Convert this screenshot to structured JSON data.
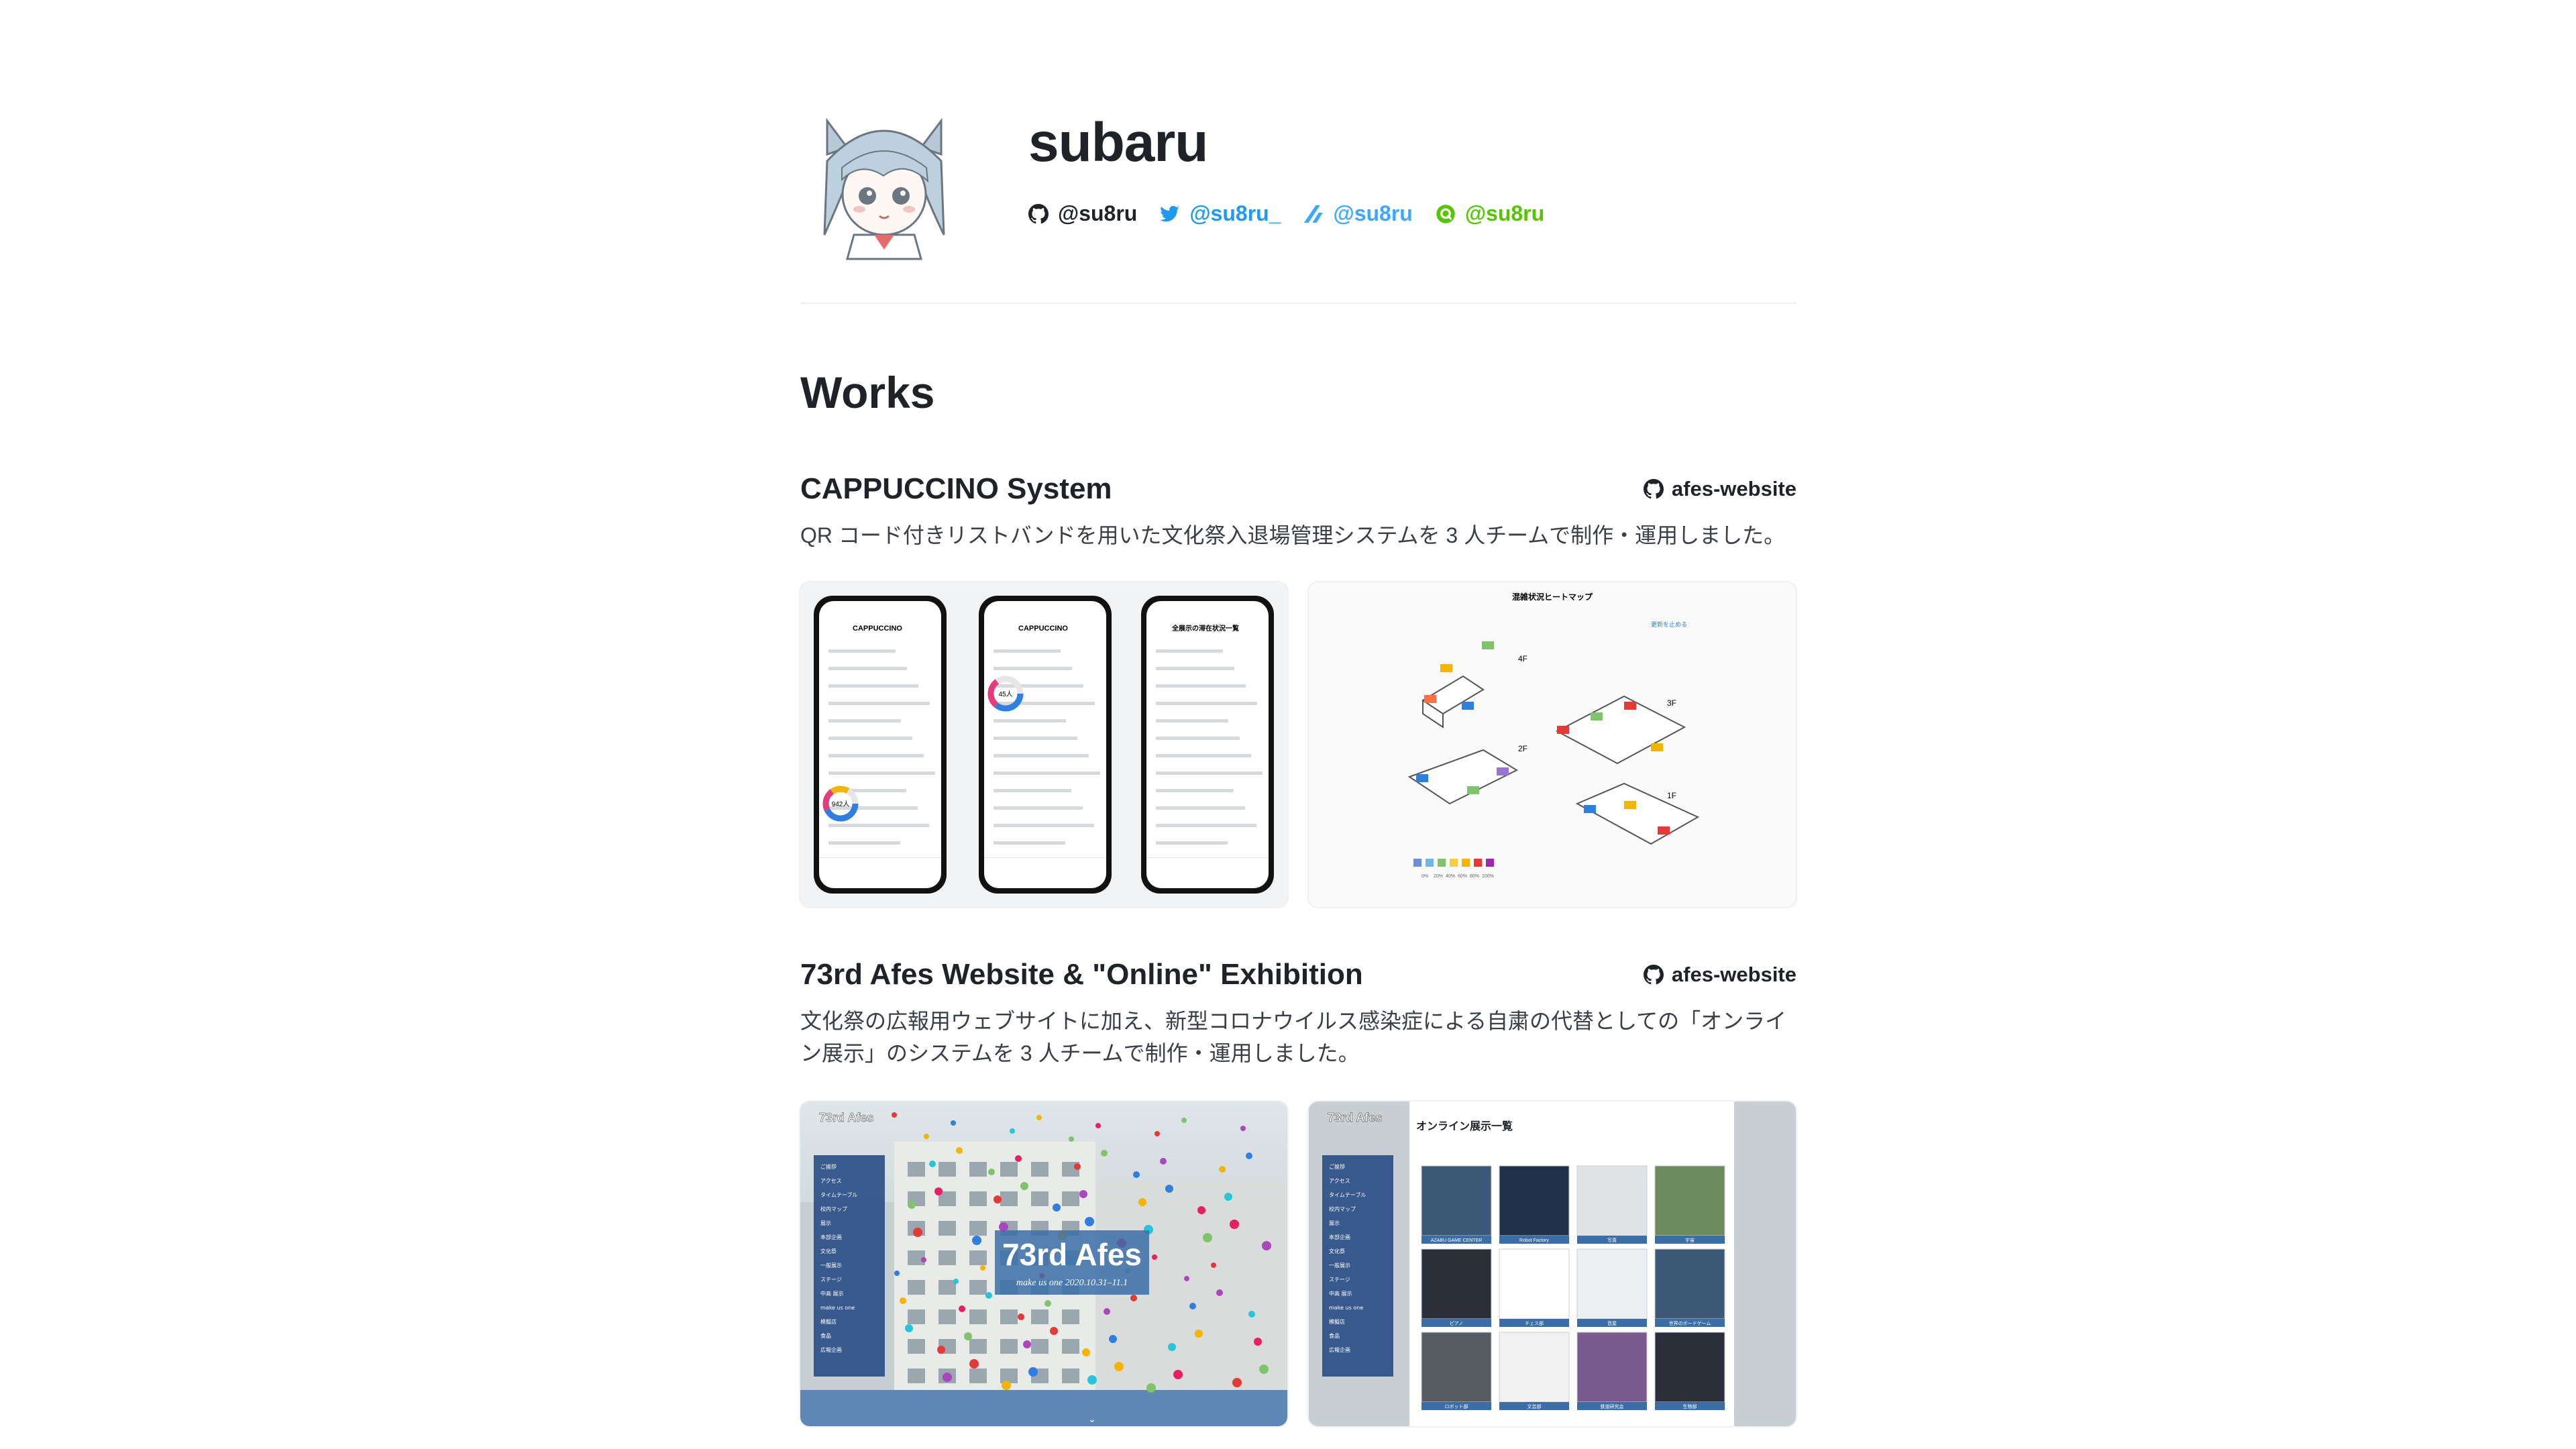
{
  "profile": {
    "name": "subaru",
    "links": [
      {
        "icon": "github-icon",
        "label": "@su8ru"
      },
      {
        "icon": "twitter-icon",
        "label": "@su8ru_"
      },
      {
        "icon": "zenn-icon",
        "label": "@su8ru"
      },
      {
        "icon": "qiita-icon",
        "label": "@su8ru"
      }
    ]
  },
  "works_title": "Works",
  "works": [
    {
      "title": "CAPPUCCINO System",
      "repo": "afes-website",
      "description": "QR コード付きリストバンドを用いた文化祭入退場管理システムを 3 人チームで制作・運用しました。",
      "shot1": {
        "app_title": "CAPPUCCINO",
        "list_title": "全展示の滞在状況一覧",
        "donut_a": "942人",
        "donut_b": "45人"
      },
      "shot2": {
        "title": "混雑状況ヒートマップ",
        "update_label": "更新を止める",
        "floors": [
          "4F",
          "3F",
          "2F",
          "1F"
        ],
        "legend": [
          "0%",
          "20%",
          "40%",
          "60%",
          "80%",
          "100%"
        ]
      }
    },
    {
      "title": "73rd Afes Website & \"Online\" Exhibition",
      "repo": "afes-website",
      "description": "文化祭の広報用ウェブサイトに加え、新型コロナウイルス感染症による自粛の代替としての「オンライン展示」のシステムを 3 人チームで制作・運用しました。",
      "shot1": {
        "logo": "73rd Afes",
        "hero": "73rd Afes",
        "tagline": "make us one  2020.10.31–11.1",
        "menu": [
          "ご挨拶",
          "アクセス",
          "タイムテーブル",
          "校内マップ",
          "展示",
          "本部企画",
          "文化祭",
          "一般展示",
          "ステージ",
          "中高 展示",
          "make us one",
          "模擬店",
          "食品",
          "広報企画"
        ]
      },
      "shot2": {
        "logo": "73rd Afes",
        "page_title": "オンライン展示一覧",
        "tiles": [
          "AZABU GAME CENTER",
          "Robot Factory",
          "写真",
          "宇宙",
          "ピアノ",
          "チェス部",
          "音屋",
          "世界のボードゲーム",
          "ロボット部",
          "文芸部",
          "鉄道研究会",
          "生物部"
        ]
      }
    }
  ]
}
